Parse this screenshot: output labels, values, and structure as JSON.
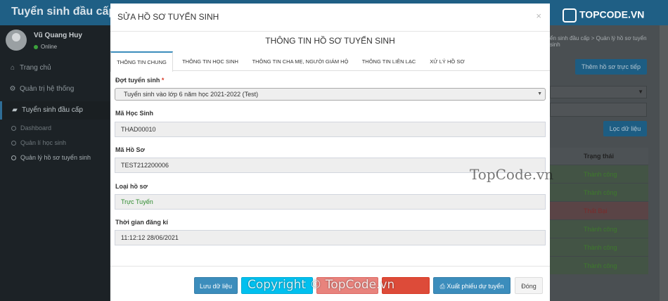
{
  "app": {
    "title": "Tuyển sinh đầu cấp"
  },
  "logo": {
    "text": "TOPCODE.VN"
  },
  "user": {
    "name": "Vũ Quang Huy",
    "status": "Online"
  },
  "sidebar": {
    "items": [
      {
        "label": "Trang chủ",
        "icon": "home-icon"
      },
      {
        "label": "Quản trị hệ thống",
        "icon": "gear-icon"
      },
      {
        "label": "Tuyển sinh đầu cấp",
        "icon": "graduation-cap-icon"
      }
    ],
    "subitems": [
      {
        "label": "Dashboard"
      },
      {
        "label": "Quản lí học sinh"
      },
      {
        "label": "Quản lý hồ sơ tuyển sinh"
      }
    ]
  },
  "background": {
    "breadcrumb": "ển sinh đầu cấp  >  Quản lý hồ sơ tuyển sinh",
    "add_button": "Thêm hồ sơ trực tiếp",
    "filter_button": "Lọc dữ liệu",
    "status_header": "Trạng thái",
    "rows": [
      "Thành công",
      "Thành công",
      "Thất Bại",
      "Thành công",
      "Thành công",
      "Thành công"
    ]
  },
  "modal": {
    "title": "SỬA HỒ SƠ TUYỂN SINH",
    "section_title": "THÔNG TIN HỒ SƠ TUYỂN SINH",
    "tabs": [
      "THÔNG TIN CHUNG",
      "THÔNG TIN HỌC SINH",
      "THÔNG TIN CHA MẸ, NGƯỜI GIÁM HỘ",
      "THÔNG TIN LIÊN LẠC",
      "XỬ LÝ HỒ SƠ"
    ],
    "fields": {
      "round_label": "Đợt tuyển sinh",
      "round_value": "Tuyển sinh vào lớp 6 năm học 2021-2022 (Test)",
      "student_code_label": "Mã Học Sinh",
      "student_code_value": "THAD00010",
      "profile_code_label": "Mã Hồ Sơ",
      "profile_code_value": "TEST212200006",
      "profile_type_label": "Loại hồ sơ",
      "profile_type_value": "Trực Tuyến",
      "reg_time_label": "Thời gian đăng kí",
      "reg_time_value": "11:12:12 28/06/2021"
    },
    "buttons": {
      "save": "Lưu dữ liệu",
      "print": "Xuất phiếu dự tuyển",
      "close": "Đóng"
    }
  },
  "watermarks": {
    "center": "TopCode.vn",
    "bottom": "Copyright © TopCode.vn"
  }
}
